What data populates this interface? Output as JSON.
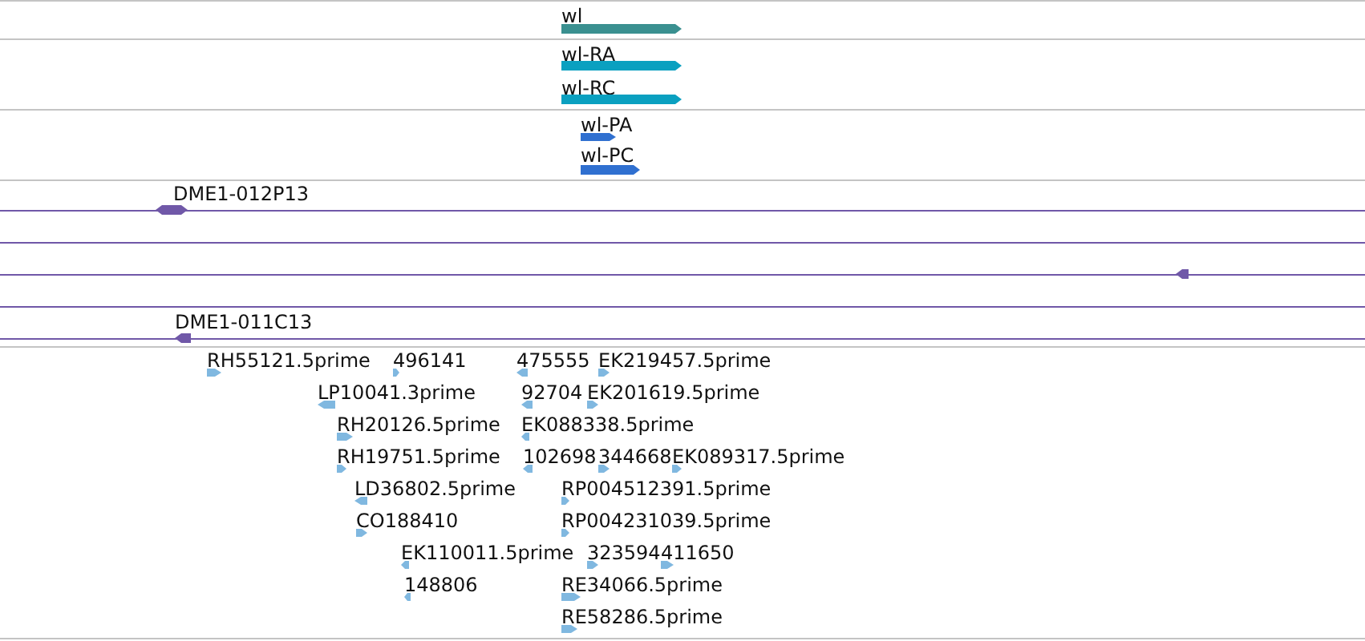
{
  "tracks": [
    {
      "kind": "gene",
      "color": "#3a9090",
      "features": [
        {
          "label": "wl",
          "forward": true,
          "reverse": false
        }
      ]
    },
    {
      "kind": "transcript",
      "color": "#0aa0c0",
      "features": [
        {
          "label": "wl-RA",
          "forward": true,
          "reverse": false
        },
        {
          "label": "wl-RC",
          "forward": true,
          "reverse": false
        }
      ]
    },
    {
      "kind": "transcript",
      "color": "#3070d0",
      "features": [
        {
          "label": "wl-PA",
          "forward": true,
          "reverse": false
        },
        {
          "label": "wl-PC",
          "forward": true,
          "reverse": false
        }
      ]
    },
    {
      "kind": "clone",
      "color": "#7058a8",
      "features": [
        {
          "label": "DME1-012P13",
          "forward": true,
          "reverse": true
        },
        {
          "forward": false,
          "reverse": true
        },
        {
          "label": "DME1-011C13",
          "forward": false,
          "reverse": true
        }
      ]
    },
    {
      "kind": "est",
      "color": "#80b8e0",
      "features": [
        {
          "label": "RH55121.5prime",
          "forward": true,
          "reverse": false
        },
        {
          "label": "496141",
          "forward": true,
          "reverse": false
        },
        {
          "label": "475555",
          "forward": false,
          "reverse": true
        },
        {
          "label": "EK219457.5prime",
          "forward": true,
          "reverse": false
        },
        {
          "label": "LP10041.3prime",
          "forward": false,
          "reverse": true
        },
        {
          "label": "92704",
          "forward": false,
          "reverse": true
        },
        {
          "label": "EK201619.5prime",
          "forward": true,
          "reverse": false
        },
        {
          "label": "RH20126.5prime",
          "forward": true,
          "reverse": false
        },
        {
          "label": "EK088338.5prime",
          "forward": false,
          "reverse": true
        },
        {
          "label": "RH19751.5prime",
          "forward": true,
          "reverse": false
        },
        {
          "label": "102698",
          "forward": false,
          "reverse": true
        },
        {
          "label": "344668",
          "forward": true,
          "reverse": false
        },
        {
          "label": "EK089317.5prime",
          "forward": true,
          "reverse": false
        },
        {
          "label": "LD36802.5prime",
          "forward": false,
          "reverse": true
        },
        {
          "label": "RP004512391.5prime",
          "forward": true,
          "reverse": false
        },
        {
          "label": "CO188410",
          "forward": true,
          "reverse": false
        },
        {
          "label": "RP004231039.5prime",
          "forward": true,
          "reverse": false
        },
        {
          "label": "EK110011.5prime",
          "forward": false,
          "reverse": true
        },
        {
          "label": "323594",
          "forward": true,
          "reverse": false
        },
        {
          "label": "411650",
          "forward": true,
          "reverse": false
        },
        {
          "label": "148806",
          "forward": false,
          "reverse": true
        },
        {
          "label": "RE34066.5prime",
          "forward": true,
          "reverse": false
        },
        {
          "label": "RE58286.5prime",
          "forward": true,
          "reverse": false
        }
      ]
    }
  ]
}
